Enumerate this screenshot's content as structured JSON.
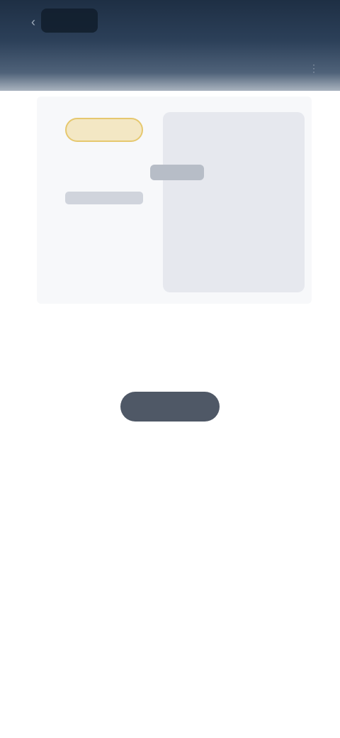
{
  "header": {
    "back_icon": "chevron-left-icon",
    "action_label": "",
    "subtitle": "",
    "sub_icon": "more-icon"
  },
  "empty_state": {
    "message": "",
    "button_label": ""
  },
  "footer": {
    "link_label": ""
  },
  "colors": {
    "header_top": "#1e2f44",
    "badge": "#f3e7c4",
    "button": "#4f5866"
  }
}
